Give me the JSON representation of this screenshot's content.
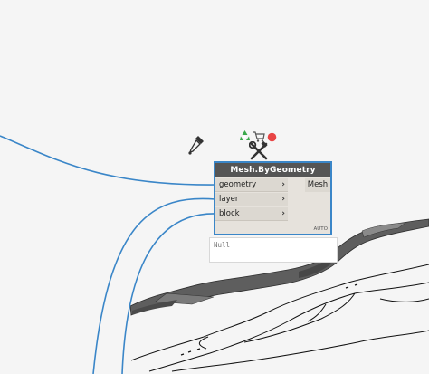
{
  "node": {
    "title": "Mesh.ByGeometry",
    "inputs": [
      {
        "label": "geometry"
      },
      {
        "label": "layer"
      },
      {
        "label": "block"
      }
    ],
    "output": {
      "label": "Mesh"
    },
    "lacing": "AUTO",
    "preview": {
      "value": "Null"
    }
  },
  "toolbar": {
    "icons": [
      "recycle-icon",
      "cart-icon",
      "record-icon",
      "tools-icon",
      "eyedropper-icon"
    ]
  },
  "colors": {
    "wire": "#3a86c8",
    "node_border": "#3a86c8",
    "node_header": "#555555",
    "node_body": "#e6e2dc",
    "mesh_fill": "#666666",
    "background": "#f5f5f5"
  }
}
